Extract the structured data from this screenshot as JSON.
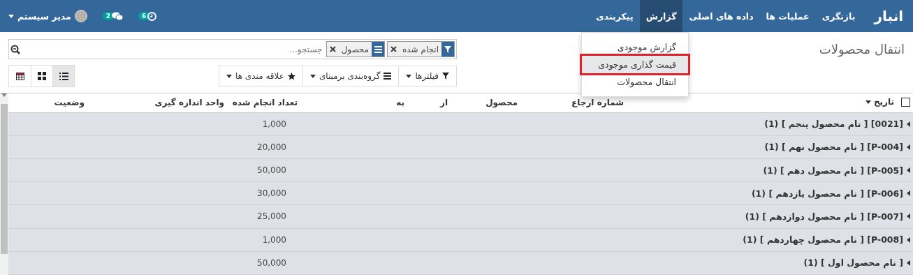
{
  "navbar": {
    "brand": "انبار",
    "menu": [
      {
        "label": "بازنگری",
        "selected": false
      },
      {
        "label": "عملیات ها",
        "selected": false
      },
      {
        "label": "داده های اصلی",
        "selected": false
      },
      {
        "label": "گزارش",
        "selected": true
      },
      {
        "label": "پیکربندی",
        "selected": false
      }
    ],
    "activities_count": "6",
    "messages_count": "2",
    "user": "مدیر سیستم"
  },
  "dropdown": [
    {
      "label": "گزارش موجودی",
      "selected": false
    },
    {
      "label": "قیمت گذاری موجودی",
      "selected": true
    },
    {
      "label": "انتقال محصولات",
      "selected": false
    }
  ],
  "page_title": "انتقال محصولات",
  "search": {
    "placeholder": "جستجو...",
    "facets": [
      {
        "kind": "filter",
        "label": "انجام شده"
      },
      {
        "kind": "groupby",
        "label": "محصول"
      }
    ]
  },
  "search_buttons": [
    {
      "kind": "filter",
      "label": "فیلترها"
    },
    {
      "kind": "groupby",
      "label": "گروه‌بندی برمبنای"
    },
    {
      "kind": "favorite",
      "label": "علاقه مندی ها"
    }
  ],
  "views": [
    {
      "kind": "list",
      "selected": true
    },
    {
      "kind": "kanban",
      "selected": false
    },
    {
      "kind": "pivot",
      "selected": false
    }
  ],
  "table": {
    "select_all": false,
    "columns": [
      "تاریخ",
      "شماره ارجاع",
      "محصول",
      "از",
      "به",
      "تعداد انجام شده",
      "واحد اندازه گیری",
      "وضعیت"
    ],
    "groups": [
      {
        "label": "[0021] [ نام محصول پنجم ] (1)",
        "quantity": "1,000",
        "expanded": false
      },
      {
        "label": "[P-004] [ نام محصول نهم ] (1)",
        "quantity": "20,000",
        "expanded": false
      },
      {
        "label": "[P-005] [ نام محصول دهم ] (1)",
        "quantity": "50,000",
        "expanded": false
      },
      {
        "label": "[P-006] [ نام محصول یازدهم ] (1)",
        "quantity": "30,000",
        "expanded": false
      },
      {
        "label": "[P-007] [ نام محصول دوازدهم ] (1)",
        "quantity": "25,000",
        "expanded": false
      },
      {
        "label": "[P-008] [ نام محصول چهاردهم ] (1)",
        "quantity": "1,000",
        "expanded": false
      },
      {
        "label": "[ نام محصول اول ] (1)",
        "quantity": "50,000",
        "expanded": false
      }
    ]
  }
}
